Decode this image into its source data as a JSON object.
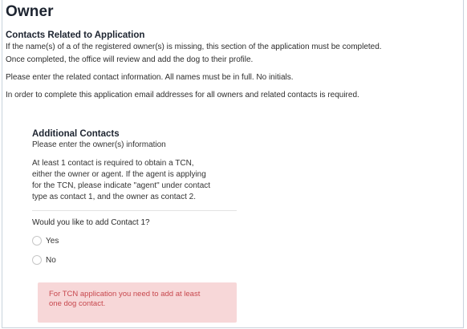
{
  "page": {
    "title": "Owner",
    "section_title": "Contacts Related to Application",
    "intro": "If the name(s) of a of the registered owner(s) is missing, this section of the application must be completed.",
    "intro_line2": "Once completed, the office will review and add the dog to their profile.",
    "contact_info": "Please enter the related contact information. All names must be in full. No initials.",
    "email_required": "In order to complete this application email addresses for all owners and related contacts is required."
  },
  "additional_contacts": {
    "title": "Additional Contacts",
    "subtitle": "Please enter the owner(s) information",
    "info_line1": "At least 1 contact is required to obtain a TCN,",
    "info_line2": "either the owner or agent. If the agent is applying",
    "info_line3": "for the TCN, please indicate \"agent\" under contact",
    "info_line4": "type as contact 1, and the owner as contact 2.",
    "question": "Would you like to add Contact 1?",
    "options": [
      "Yes",
      "No"
    ],
    "alert_line1": "For TCN application you need to add at least",
    "alert_line2": "one dog contact."
  },
  "colors": {
    "alert_background": "#f7d7d8",
    "alert_text": "#c7484e",
    "heading": "#1d2430"
  }
}
